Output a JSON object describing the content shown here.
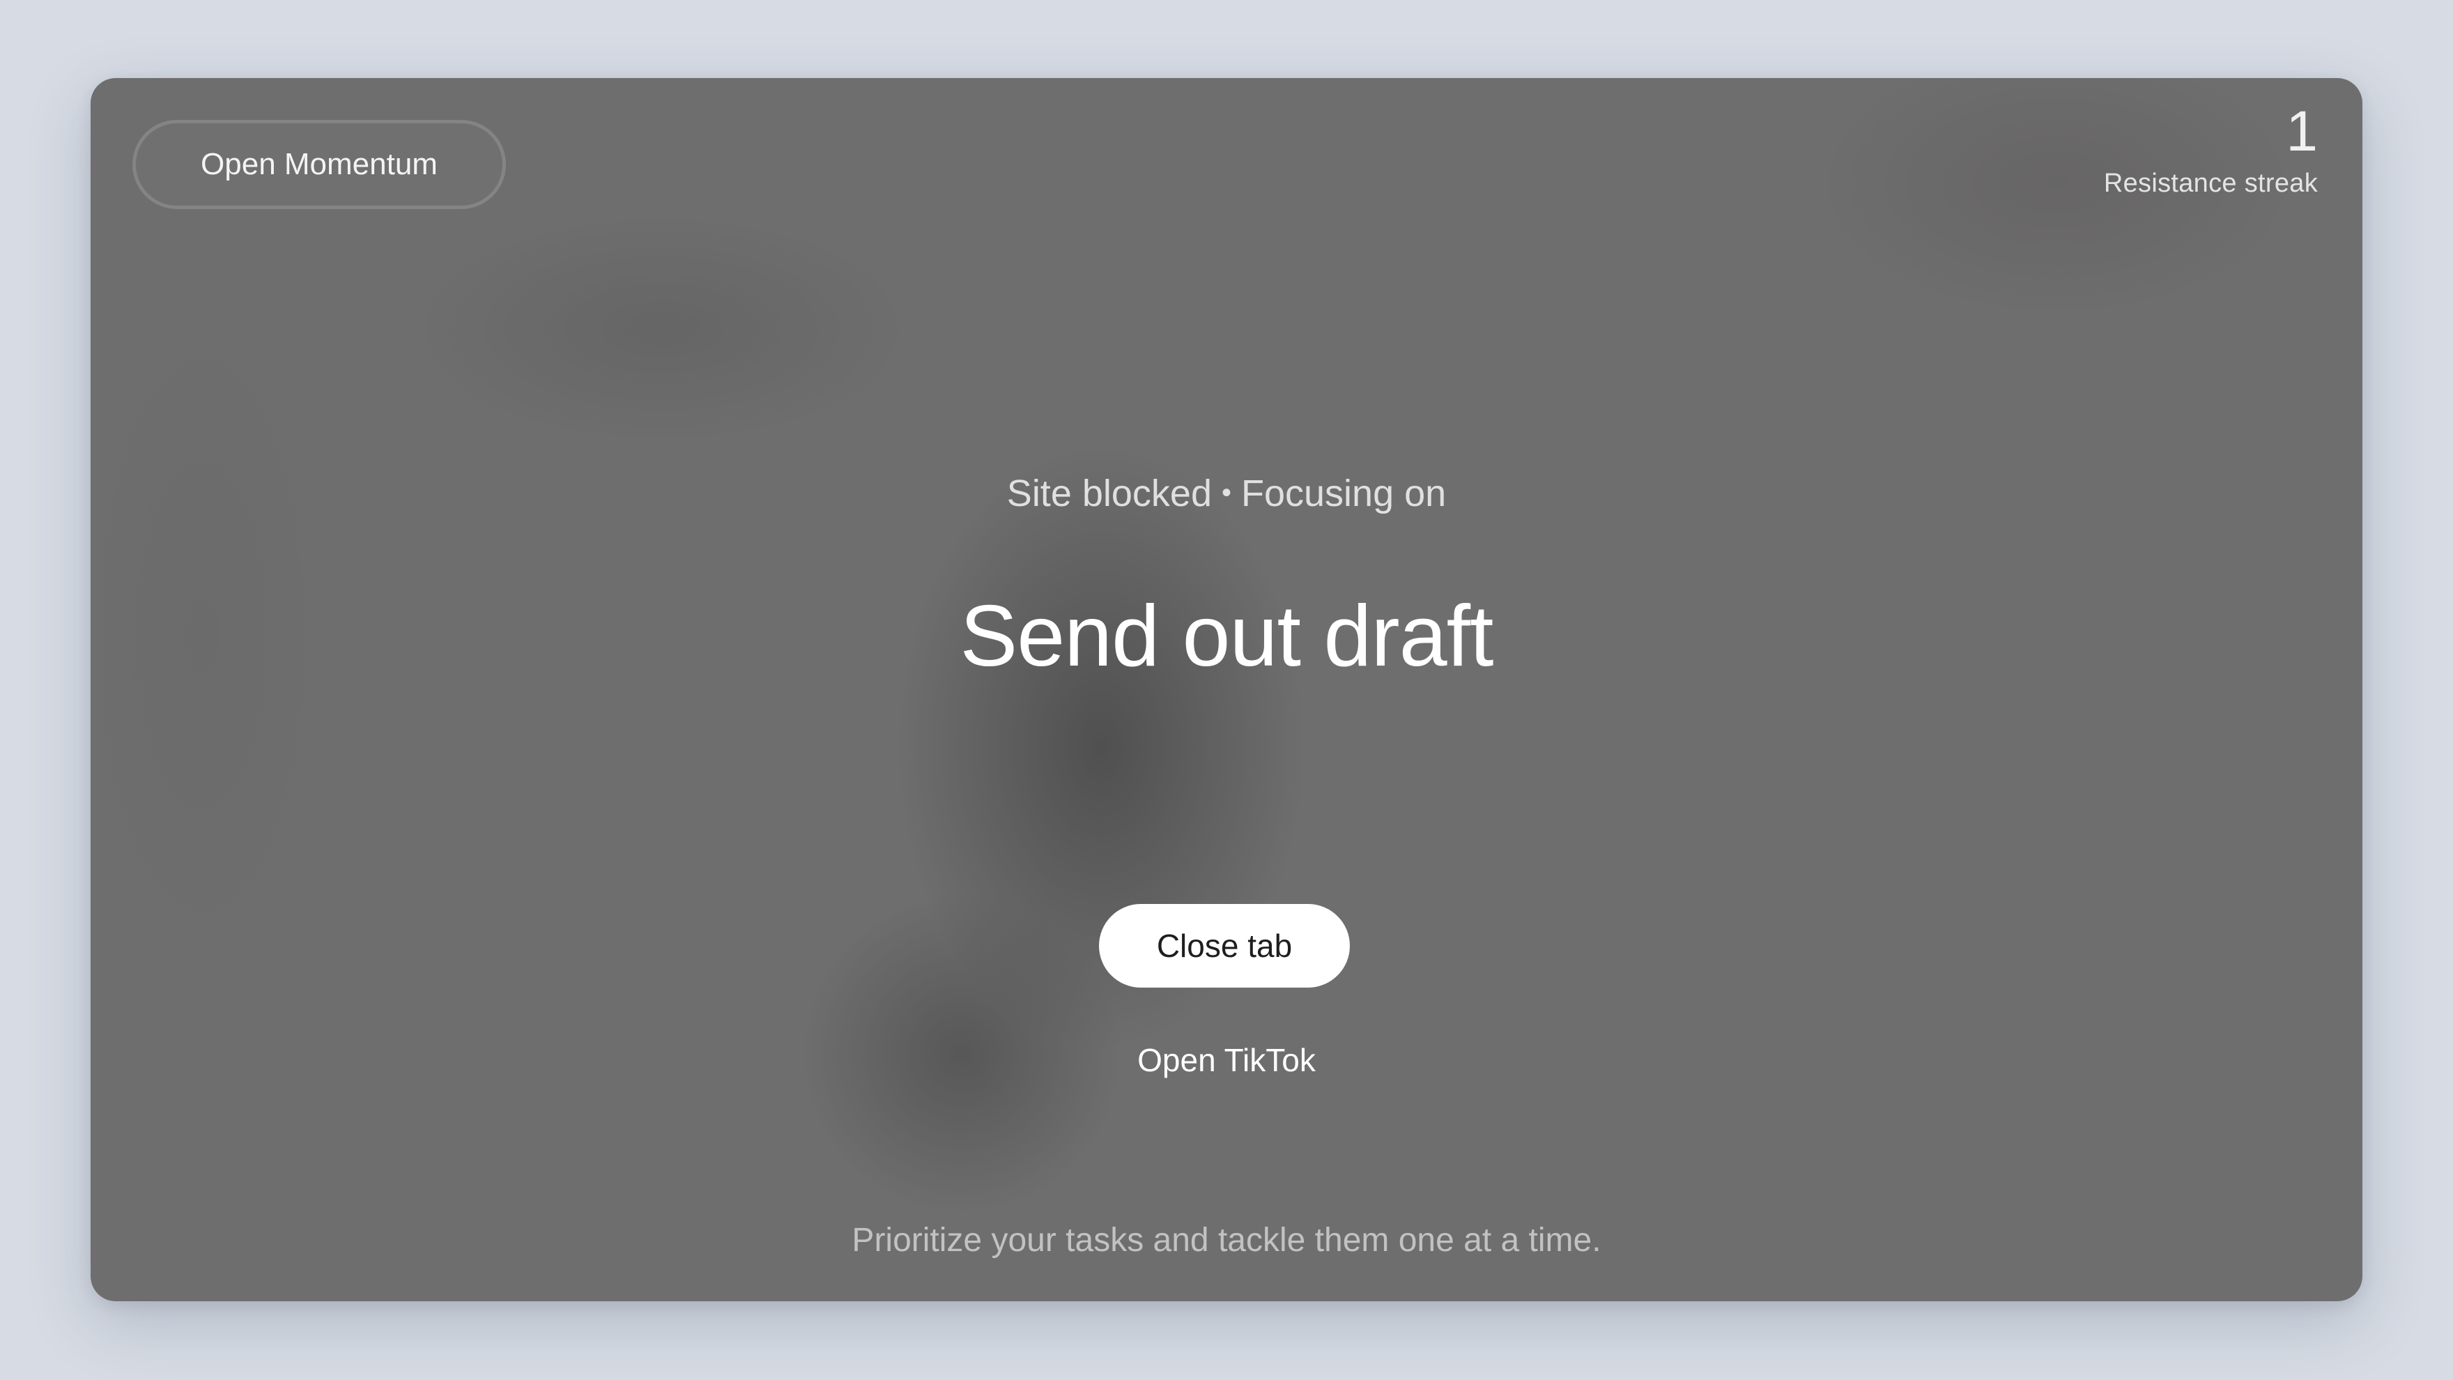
{
  "header": {
    "momentum_button_label": "Open Momentum"
  },
  "streak": {
    "count": "1",
    "label": "Resistance streak"
  },
  "main": {
    "status": "Site blocked",
    "separator": "•",
    "focus_prefix": "Focusing on",
    "task": "Send out draft",
    "close_button_label": "Close tab",
    "open_site_label": "Open TikTok"
  },
  "footer": {
    "tip": "Prioritize your tasks and tackle them one at a time."
  },
  "colors": {
    "page_background": "#d6dbe4",
    "overlay": "#6e6e6e",
    "primary_button": "#ffffff"
  }
}
